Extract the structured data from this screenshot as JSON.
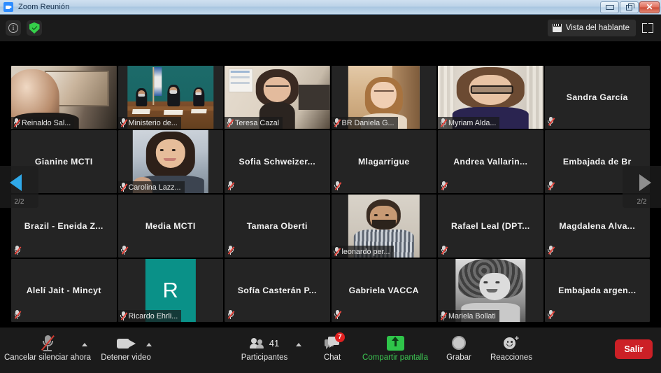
{
  "window": {
    "title": "Zoom Reunión",
    "minimize_label": "Minimizar",
    "restore_label": "Restaurar",
    "close_label": "Cerrar",
    "close_glyph": "✕"
  },
  "topbar": {
    "info_glyph": "i",
    "encryption_label": "Cifrado",
    "view_button_label": "Vista del hablante",
    "fullscreen_label": "Pantalla completa"
  },
  "gallery": {
    "page_prev_label": "2/2",
    "page_next_label": "2/2",
    "tiles": [
      {
        "name": "Reinaldo Sal...",
        "type": "video",
        "muted": true,
        "video": "reinaldo"
      },
      {
        "name": "Ministerio de...",
        "type": "video",
        "muted": true,
        "video": "ministerio"
      },
      {
        "name": "Teresa Cazal",
        "type": "video",
        "muted": true,
        "video": "teresa"
      },
      {
        "name": "BR Daniela G...",
        "type": "video",
        "muted": true,
        "video": "daniela"
      },
      {
        "name": "Myriam Alda...",
        "type": "video",
        "muted": true,
        "video": "myriam"
      },
      {
        "name": "Sandra García",
        "type": "name",
        "muted": true
      },
      {
        "name": "Gianine MCTI",
        "type": "name",
        "muted": false
      },
      {
        "name": "Carolina Lazz...",
        "type": "video",
        "muted": true,
        "video": "carolina"
      },
      {
        "name": "Sofia  Schweizer...",
        "type": "name",
        "muted": true
      },
      {
        "name": "Mlagarrigue",
        "type": "name",
        "muted": true
      },
      {
        "name": "Andrea  Vallarin...",
        "type": "name",
        "muted": true
      },
      {
        "name": "Embajada de Br",
        "type": "name",
        "muted": true
      },
      {
        "name": "Brazil - Eneida Z...",
        "type": "name",
        "muted": true
      },
      {
        "name": "Media MCTI",
        "type": "name",
        "muted": true
      },
      {
        "name": "Tamara Oberti",
        "type": "name",
        "muted": true
      },
      {
        "name": "leonardo per...",
        "type": "video",
        "muted": true,
        "video": "leonardo"
      },
      {
        "name": "Rafael Leal (DPT...",
        "type": "name",
        "muted": true
      },
      {
        "name": "Magdalena  Alva...",
        "type": "name",
        "muted": true
      },
      {
        "name": "Alelí Jait - Mincyt",
        "type": "name",
        "muted": true
      },
      {
        "name": "Ricardo Ehrli...",
        "type": "initial",
        "muted": true,
        "initial": "R",
        "avatar_color": "#0a9188"
      },
      {
        "name": "Sofía Casterán P...",
        "type": "name",
        "muted": true
      },
      {
        "name": "Gabriela VACCA",
        "type": "name",
        "muted": true
      },
      {
        "name": "Mariela Bollati",
        "type": "video",
        "muted": true,
        "video": "mariela"
      },
      {
        "name": "Embajada  argen...",
        "type": "name",
        "muted": true
      }
    ]
  },
  "toolbar": {
    "mute_label": "Cancelar silenciar ahora",
    "video_label": "Detener video",
    "participants_label": "Participantes",
    "participants_count": "41",
    "chat_label": "Chat",
    "chat_badge": "7",
    "share_label": "Compartir pantalla",
    "record_label": "Grabar",
    "reactions_label": "Reacciones",
    "leave_label": "Salir"
  },
  "colors": {
    "accent_blue": "#2fa8e8",
    "share_green": "#2fc54a",
    "leave_red": "#cc2026",
    "badge_red": "#e02020",
    "mute_slash_red": "#e8483f"
  }
}
